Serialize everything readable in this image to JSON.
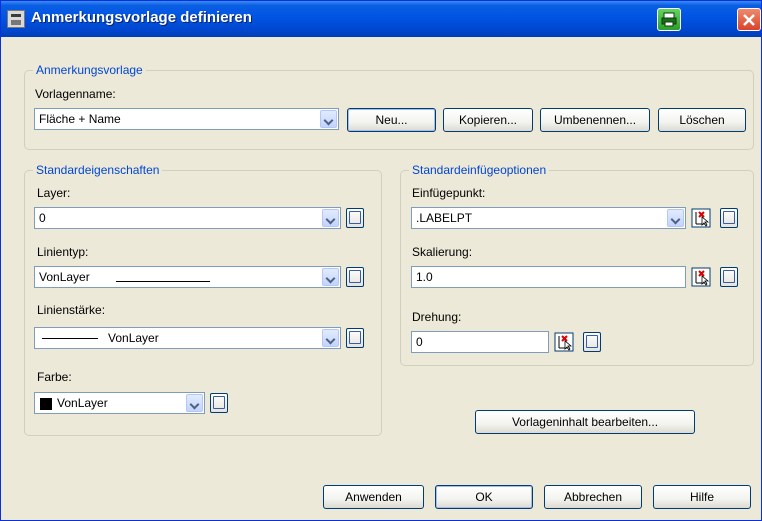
{
  "window": {
    "title": "Anmerkungsvorlage definieren",
    "icons": {
      "app": "app-map-icon",
      "print": "print-icon",
      "close": "close-icon"
    },
    "colors": {
      "titlebar": "#0054e3",
      "group_legend": "#0046d5",
      "close": "#d8432a",
      "print": "#2e9e2a"
    }
  },
  "template_group": {
    "legend": "Anmerkungsvorlage",
    "name_label": "Vorlagenname:",
    "name_value": "Fläche + Name",
    "buttons": {
      "new": "Neu...",
      "copy": "Kopieren...",
      "rename": "Umbenennen...",
      "delete": "Löschen"
    }
  },
  "props_group": {
    "legend": "Standardeigenschaften",
    "layer_label": "Layer:",
    "layer_value": "0",
    "linetype_label": "Linientyp:",
    "linetype_value": "VonLayer",
    "lineweight_label": "Linienstärke:",
    "lineweight_value": "VonLayer",
    "color_label": "Farbe:",
    "color_value": "VonLayer"
  },
  "insert_group": {
    "legend": "Standardeinfügeoptionen",
    "insertion_label": "Einfügepunkt:",
    "insertion_value": ".LABELPT",
    "scale_label": "Skalierung:",
    "scale_value": "1.0",
    "rotation_label": "Drehung:",
    "rotation_value": "0"
  },
  "edit_content_button": "Vorlageninhalt bearbeiten...",
  "footer": {
    "apply": "Anwenden",
    "ok": "OK",
    "cancel": "Abbrechen",
    "help": "Hilfe"
  }
}
